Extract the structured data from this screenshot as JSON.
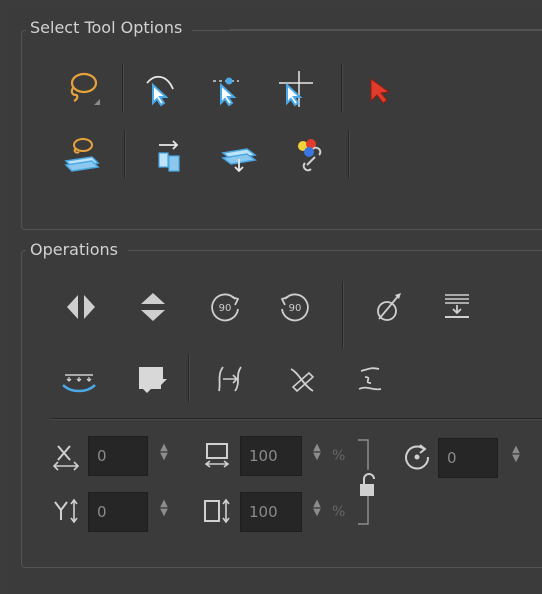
{
  "select_tool_options": {
    "title": "Select Tool Options",
    "tools_row1": [
      "lasso-icon",
      "snap-to-contour-icon",
      "snap-to-point-icon",
      "snap-to-grid-icon",
      "red-select-arrow-icon"
    ],
    "tools_row2": [
      "works-on-layers-icon",
      "send-to-layer-icon",
      "flatten-icon",
      "color-link-icon"
    ]
  },
  "operations": {
    "title": "Operations",
    "tools_row1": [
      "flip-horizontal-icon",
      "flip-vertical-icon",
      "rotate-90-cw-icon",
      "rotate-90-ccw-icon",
      "smooth-icon",
      "flatten-layer-icon"
    ],
    "tools_row2": [
      "convert-to-pencil-icon",
      "create-color-art-icon",
      "adjust-pencil-icon",
      "remove-pencil-icon",
      "straighten-icon"
    ],
    "fields": {
      "x": {
        "value": "0"
      },
      "y": {
        "value": "0"
      },
      "width": {
        "value": "100",
        "unit": "%"
      },
      "height": {
        "value": "100",
        "unit": "%"
      },
      "angle": {
        "value": "0"
      }
    }
  },
  "colors": {
    "accent_orange": "#e8a23a",
    "accent_blue": "#4aa9e6",
    "accent_red": "#e03b2b"
  }
}
